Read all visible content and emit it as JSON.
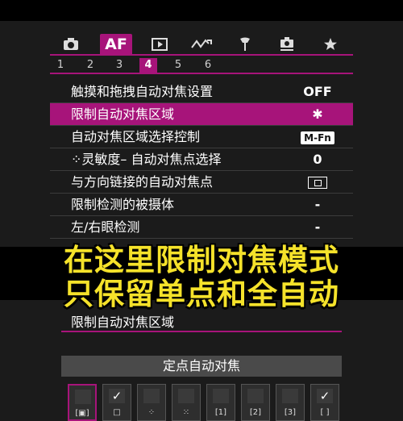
{
  "tabs": [
    {
      "icon": "camera-icon",
      "glyph": "📷"
    },
    {
      "icon": "af-tab",
      "label": "AF"
    },
    {
      "icon": "playback-icon",
      "glyph": "▶"
    },
    {
      "icon": "wave-icon",
      "glyph": "∿"
    },
    {
      "icon": "wrench-icon",
      "glyph": "🔧"
    },
    {
      "icon": "custom-camera-icon",
      "glyph": "📷"
    },
    {
      "icon": "star-icon",
      "glyph": "★"
    }
  ],
  "pages": [
    "1",
    "2",
    "3",
    "4",
    "5",
    "6"
  ],
  "active_page": "4",
  "menu": [
    {
      "label": "触摸和拖拽自动对焦设置",
      "value": "OFF"
    },
    {
      "label": "限制自动对焦区域",
      "value": "✱"
    },
    {
      "label": "自动对焦区域选择控制",
      "value": "M-Fn"
    },
    {
      "label": "⁘灵敏度– 自动对焦点选择",
      "value": "0"
    },
    {
      "label": "与方向链接的自动对焦点",
      "value": ""
    },
    {
      "label": "限制检测的被摄体",
      "value": "-"
    },
    {
      "label": "左/右眼检测",
      "value": "-"
    }
  ],
  "overlay": {
    "line1": "在这里限制对焦模式",
    "line2": "只保留单点和全自动"
  },
  "submenu": {
    "title": "限制自动对焦区域",
    "mode": "定点自动对焦",
    "cells": [
      {
        "checked": false,
        "glyph": "[▣]"
      },
      {
        "checked": true,
        "glyph": "□"
      },
      {
        "checked": false,
        "glyph": "⁘"
      },
      {
        "checked": false,
        "glyph": "⁙"
      },
      {
        "checked": false,
        "glyph": "[1]"
      },
      {
        "checked": false,
        "glyph": "[2]"
      },
      {
        "checked": false,
        "glyph": "[3]"
      },
      {
        "checked": true,
        "glyph": "[ ]"
      }
    ],
    "check_mark": "✓"
  },
  "colors": {
    "accent": "#a7147a",
    "overlay_text": "#f5e22a"
  }
}
